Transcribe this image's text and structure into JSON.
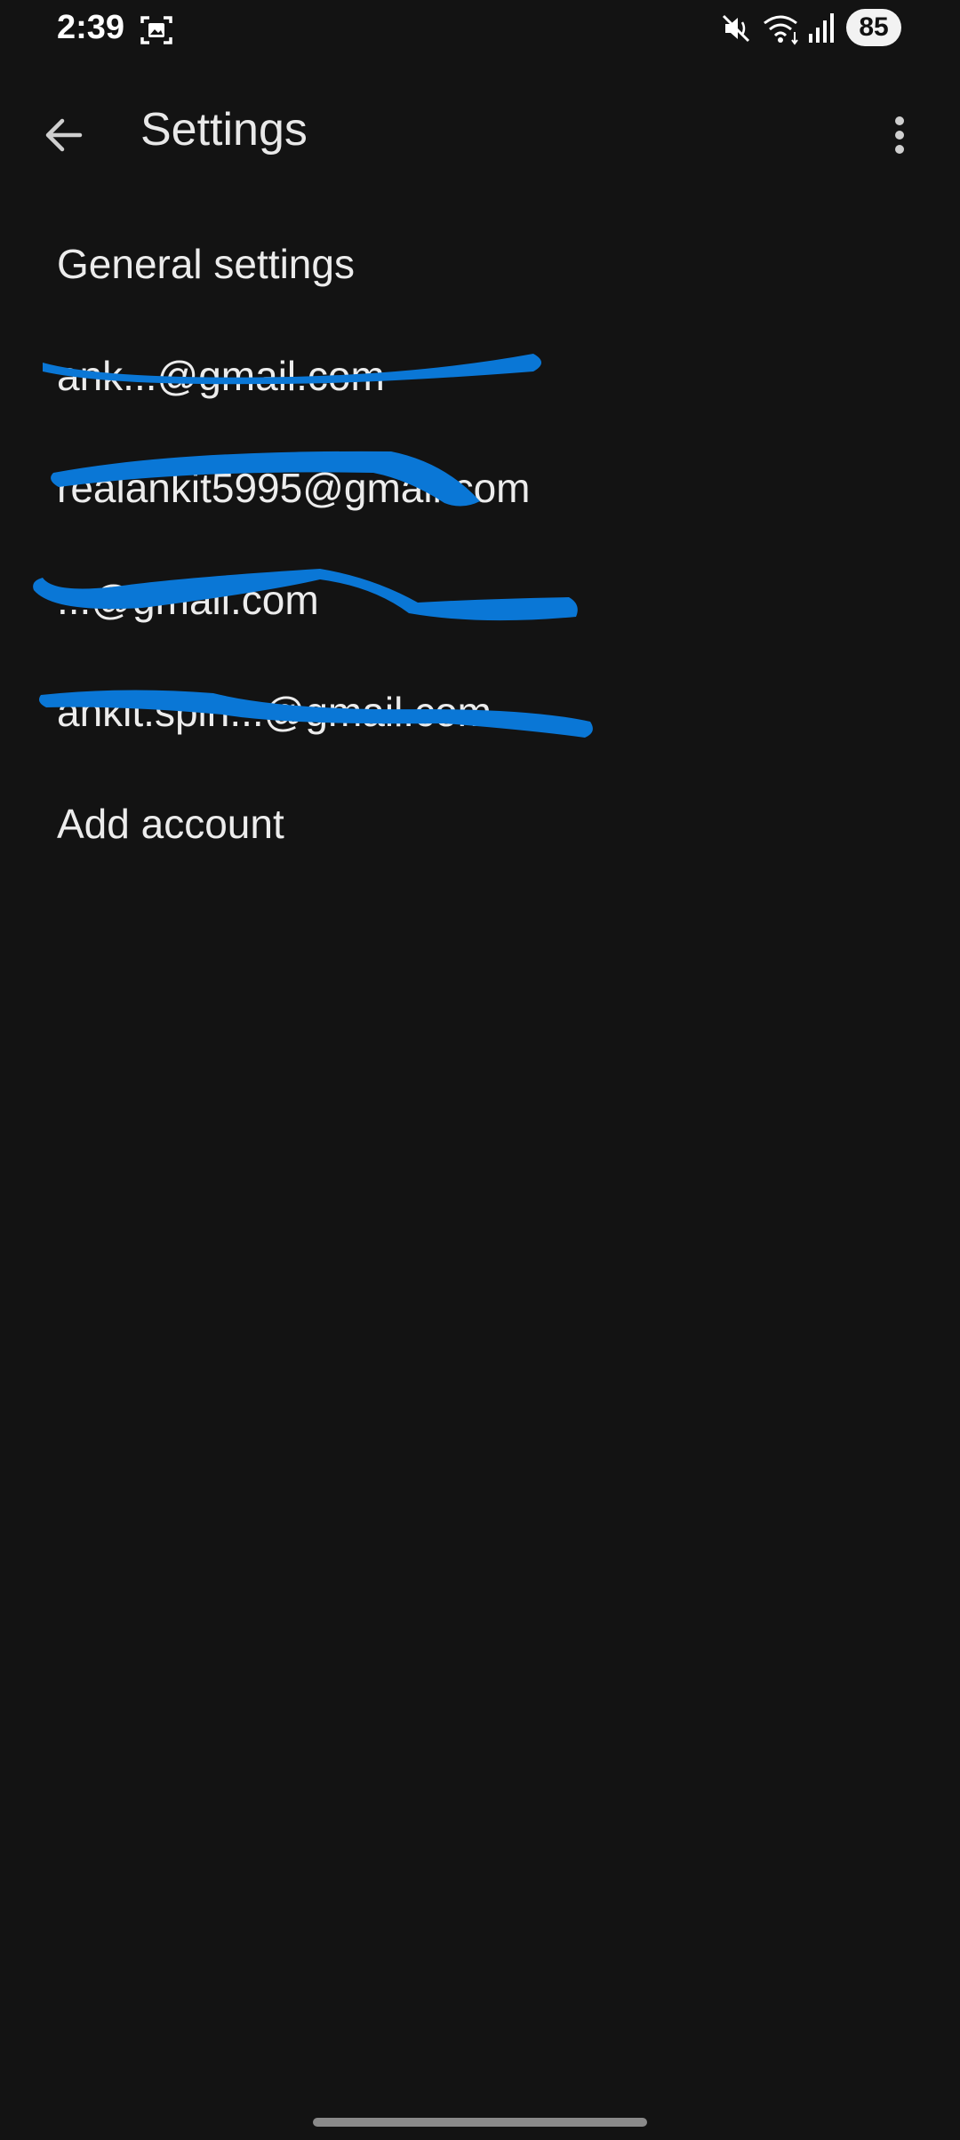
{
  "status_bar": {
    "time": "2:39",
    "battery": "85",
    "icons": [
      "screenshot-icon",
      "mute-icon",
      "wifi-icon",
      "signal-icon"
    ]
  },
  "app_bar": {
    "title": "Settings",
    "back_icon": "arrow-left-icon",
    "more_icon": "more-vert-icon"
  },
  "list": {
    "general": "General settings",
    "accounts": [
      "ank...@gmail.com",
      "realankit5995@gmail.com",
      "...@gmail.com",
      "ankit.spin...@gmail.com"
    ],
    "add_account": "Add account"
  },
  "colors": {
    "background": "#131313",
    "text": "#ececec",
    "redaction": "#0a77d6"
  }
}
